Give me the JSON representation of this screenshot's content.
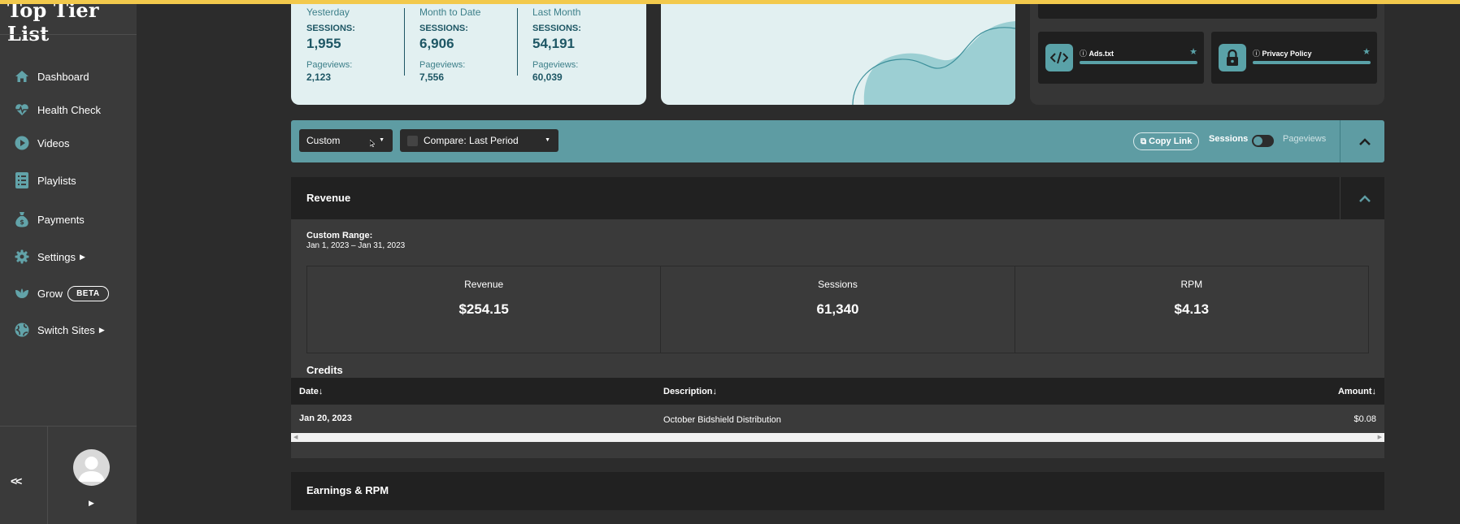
{
  "sidebar": {
    "brand": "Top Tier List",
    "items": [
      {
        "label": "Dashboard",
        "icon": "home-icon"
      },
      {
        "label": "Health Check",
        "icon": "heartbeat-icon"
      },
      {
        "label": "Videos",
        "icon": "play-icon"
      },
      {
        "label": "Playlists",
        "icon": "list-icon"
      },
      {
        "label": "Payments",
        "icon": "money-bag-icon"
      },
      {
        "label": "Settings",
        "icon": "gear-icon"
      },
      {
        "label": "Grow",
        "icon": "leaf-icon",
        "badge": "BETA"
      },
      {
        "label": "Switch Sites",
        "icon": "globe-icon"
      }
    ],
    "collapse_label": "<<"
  },
  "stats": [
    {
      "period": "Yesterday",
      "sessions_label": "SESSIONS:",
      "sessions": "1,955",
      "pageviews_label": "Pageviews:",
      "pageviews": "2,123"
    },
    {
      "period": "Month to Date",
      "sessions_label": "SESSIONS:",
      "sessions": "6,906",
      "pageviews_label": "Pageviews:",
      "pageviews": "7,556"
    },
    {
      "period": "Last Month",
      "sessions_label": "SESSIONS:",
      "sessions": "54,191",
      "pageviews_label": "Pageviews:",
      "pageviews": "60,039"
    }
  ],
  "tools": [
    {
      "label": "Ads.txt",
      "icon": "code-icon"
    },
    {
      "label": "Privacy Policy",
      "icon": "lock-icon"
    }
  ],
  "filter": {
    "range_value": "Custom",
    "compare_value": "Compare: Last Period",
    "copy_link": "Copy Link",
    "sessions": "Sessions",
    "pageviews": "Pageviews"
  },
  "revenue": {
    "title": "Revenue",
    "range_label": "Custom Range:",
    "range_dates": "Jan 1, 2023 – Jan 31, 2023",
    "metrics": [
      {
        "label": "Revenue",
        "value": "$254.15"
      },
      {
        "label": "Sessions",
        "value": "61,340"
      },
      {
        "label": "RPM",
        "value": "$4.13"
      }
    ],
    "credits_title": "Credits",
    "columns": [
      "Date↓",
      "Description↓",
      "Amount↓"
    ],
    "rows": [
      {
        "date": "Jan 20, 2023",
        "description": "October Bidshield Distribution",
        "amount": "$0.08"
      }
    ]
  },
  "earnings": {
    "title": "Earnings & RPM"
  },
  "colors": {
    "accent": "#5e9ca3",
    "brand_bar": "#f2c94c",
    "panel": "#212121"
  }
}
